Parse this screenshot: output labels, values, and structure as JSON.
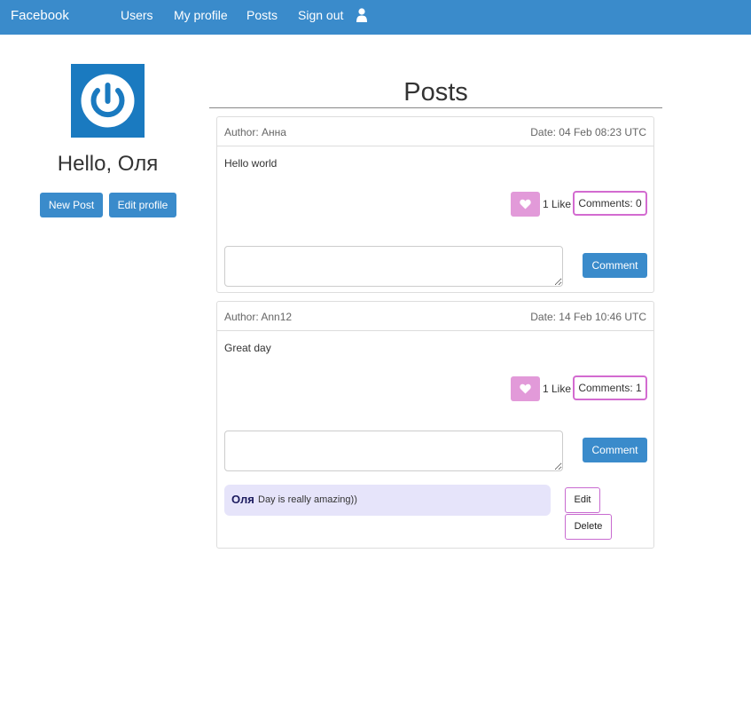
{
  "navbar": {
    "brand": "Facebook",
    "links": [
      "Users",
      "My profile",
      "Posts",
      "Sign out"
    ],
    "user_icon": "user-icon",
    "background": "#3a8bcb"
  },
  "profile": {
    "greeting": "Hello, Оля",
    "new_post_label": "New Post",
    "edit_profile_label": "Edit profile",
    "avatar_icon": "power-icon"
  },
  "page": {
    "title": "Posts"
  },
  "posts": [
    {
      "author": "Author: Анна",
      "date": "Date: 04 Feb 08:23 UTC",
      "body": "Hello world",
      "likes": "1 Like",
      "comments_label": "Comments: 0",
      "comment_button": "Comment",
      "comment_placeholder": ""
    },
    {
      "author": "Author: Ann12",
      "date": "Date: 14 Feb 10:46 UTC",
      "body": "Great day",
      "likes": "1 Like",
      "comments_label": "Comments: 1",
      "comment_button": "Comment",
      "comment_placeholder": "",
      "comments": [
        {
          "author": "Оля",
          "text": "Day is really amazing))",
          "edit_label": "Edit",
          "delete_label": "Delete"
        }
      ]
    }
  ],
  "colors": {
    "primary": "#3a8bcb",
    "like": "#e29ad9",
    "comment_border": "#d36bd0",
    "comment_bg": "#e6e4fa"
  }
}
